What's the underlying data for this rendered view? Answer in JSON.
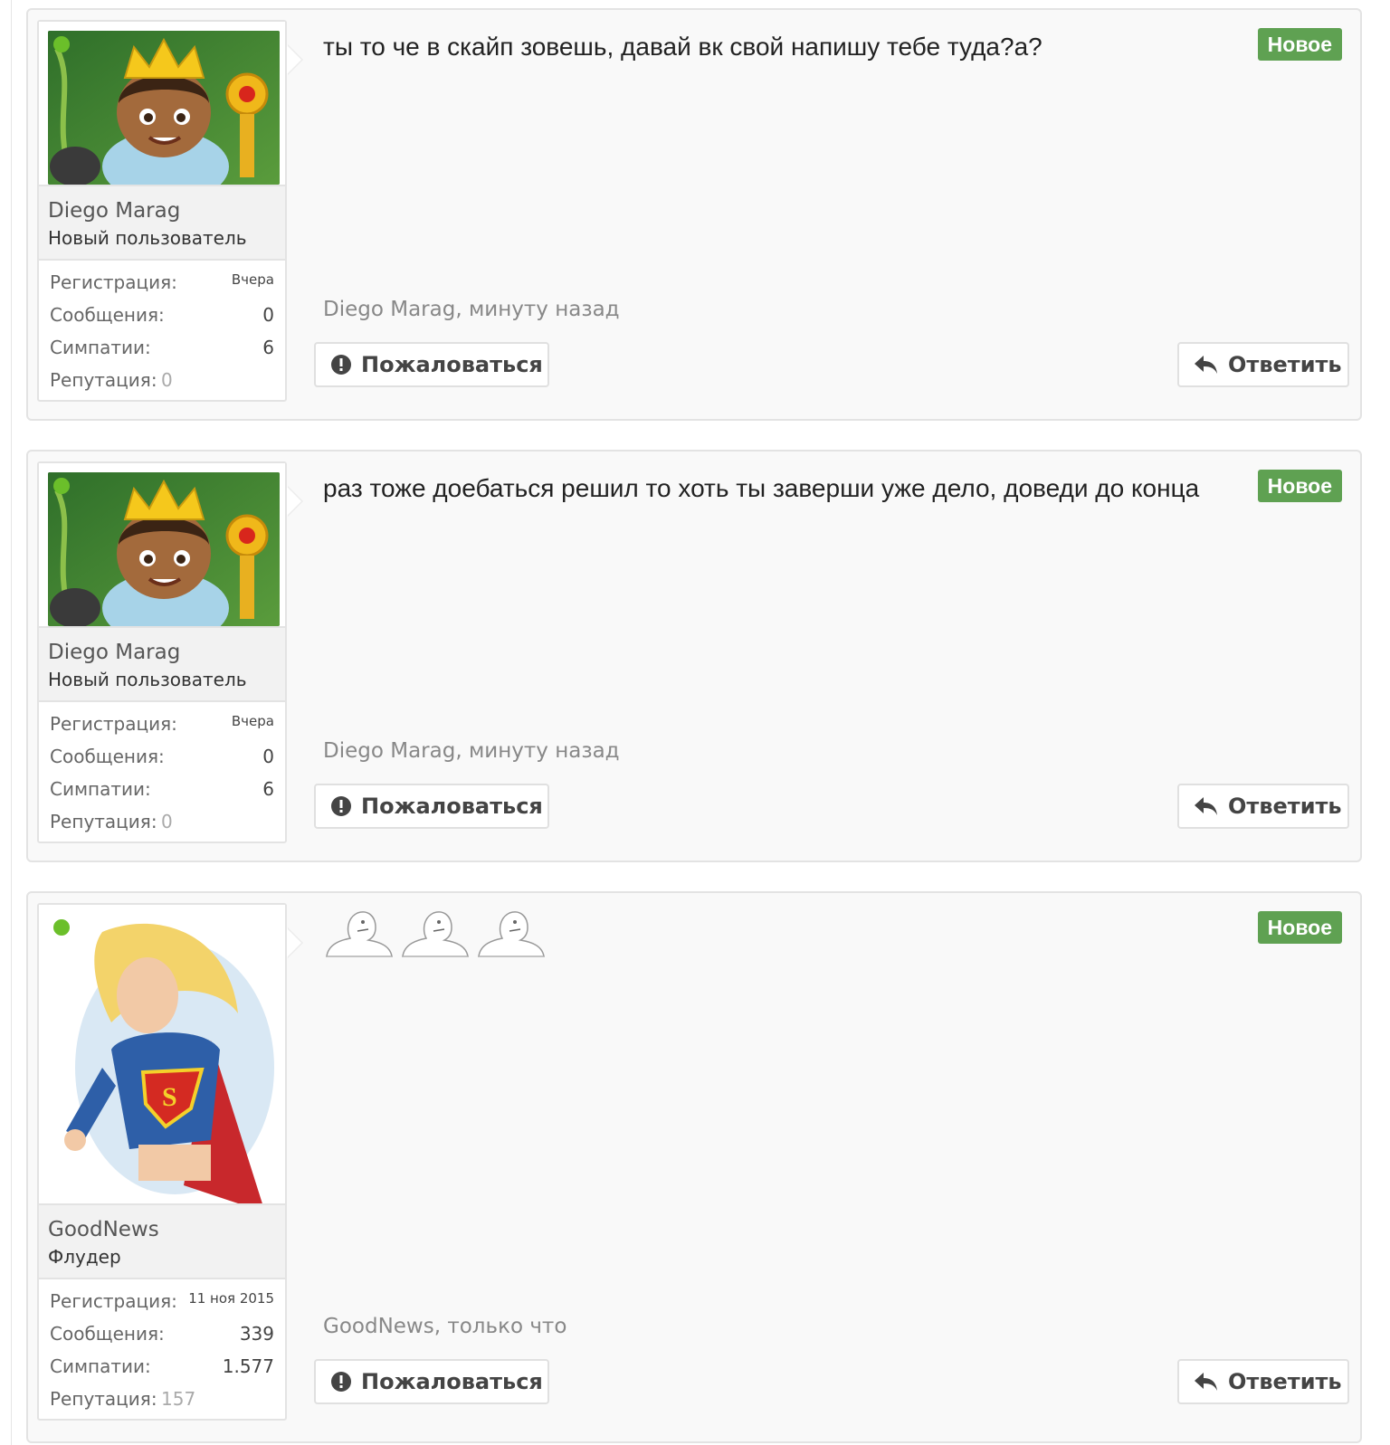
{
  "posts": [
    {
      "author": "Diego Marag",
      "user_title": "Новый пользователь",
      "stats": {
        "reg_label": "Регистрация:",
        "reg_value": "Вчера",
        "msg_label": "Сообщения:",
        "msg_value": "0",
        "likes_label": "Симпатии:",
        "likes_value": "6",
        "rep_label": "Репутация:",
        "rep_value": "0"
      },
      "message": "ты то че в скайп зовешь, давай вк свой напишу тебе туда?а?",
      "badge": "Новое",
      "meta": "Diego Marag, минуту назад",
      "report_label": "Пожаловаться",
      "reply_label": "Ответить"
    },
    {
      "author": "Diego Marag",
      "user_title": "Новый пользователь",
      "stats": {
        "reg_label": "Регистрация:",
        "reg_value": "Вчера",
        "msg_label": "Сообщения:",
        "msg_value": "0",
        "likes_label": "Симпатии:",
        "likes_value": "6",
        "rep_label": "Репутация:",
        "rep_value": "0"
      },
      "message": "раз тоже доебаться решил то хоть ты заверши уже дело, доведи до конца",
      "badge": "Новое",
      "meta": "Diego Marag, минуту назад",
      "report_label": "Пожаловаться",
      "reply_label": "Ответить"
    },
    {
      "author": "GoodNews",
      "user_title": "Флудер",
      "stats": {
        "reg_label": "Регистрация:",
        "reg_value": "11 ноя 2015",
        "msg_label": "Сообщения:",
        "msg_value": "339",
        "likes_label": "Симпатии:",
        "likes_value": "1.577",
        "rep_label": "Репутация:",
        "rep_value": "157"
      },
      "message_emotes": [
        "meme-face-icon",
        "meme-face-icon",
        "meme-face-icon"
      ],
      "badge": "Новое",
      "meta": "GoodNews, только что",
      "report_label": "Пожаловаться",
      "reply_label": "Ответить"
    }
  ],
  "colors": {
    "online": "#6bbf2a",
    "badge_new": "#5fa152"
  }
}
